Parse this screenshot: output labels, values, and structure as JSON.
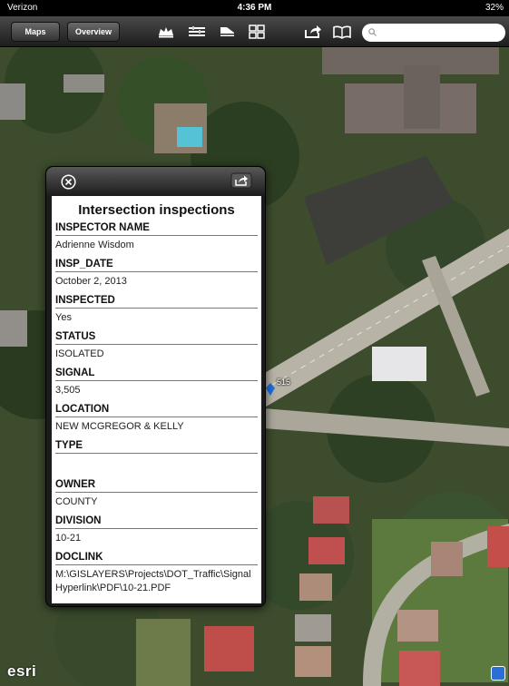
{
  "status_bar": {
    "carrier": "Verizon",
    "time": "4:36 PM",
    "battery": "32%"
  },
  "toolbar": {
    "maps_label": "Maps",
    "overview_label": "Overview",
    "icons": [
      "basemap-icon",
      "layers-icon",
      "legend-icon",
      "grid-icon",
      "share-icon",
      "bookmarks-icon"
    ],
    "search_placeholder": ""
  },
  "map": {
    "marker_label": "515",
    "logo": "esri"
  },
  "popup": {
    "title": "Intersection inspections",
    "fields": [
      {
        "label": "INSPECTOR NAME",
        "value": "Adrienne Wisdom"
      },
      {
        "label": "INSP_DATE",
        "value": "October 2, 2013"
      },
      {
        "label": "INSPECTED",
        "value": "Yes"
      },
      {
        "label": "STATUS",
        "value": "ISOLATED"
      },
      {
        "label": "SIGNAL",
        "value": "3,505"
      },
      {
        "label": "LOCATION",
        "value": "NEW MCGREGOR & KELLY"
      },
      {
        "label": "TYPE",
        "value": ""
      },
      {
        "label": "OWNER",
        "value": "COUNTY"
      },
      {
        "label": "DIVISION",
        "value": "10-21"
      },
      {
        "label": "DOCLINK",
        "value": "M:\\GISLAYERS\\Projects\\DOT_Traffic\\SignalHyperlink\\PDF\\10-21.PDF"
      }
    ]
  },
  "colors": {
    "toolbar": "#2a2a2a",
    "popup_header": "#3a3a3a",
    "accent": "#1f6fe0"
  }
}
